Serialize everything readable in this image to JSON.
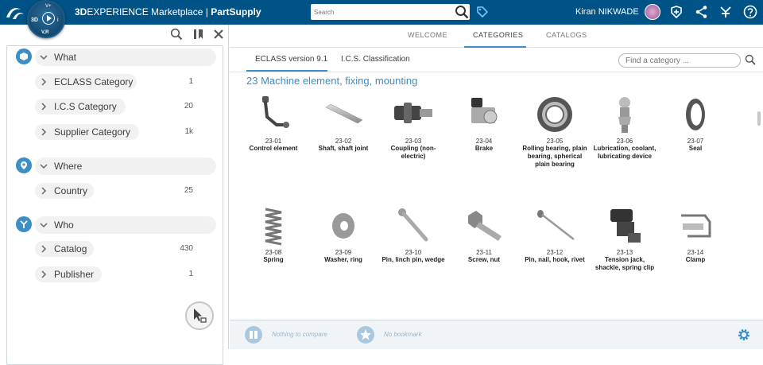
{
  "topbar": {
    "title_prefix": "3D",
    "title_rest": "EXPERIENCE Marketplace | ",
    "title_bold": "PartSupply",
    "search_placeholder": "Search",
    "user_name": "Kiran NIKWADE",
    "compass": {
      "top": "V+",
      "left": "3D",
      "right": "i",
      "bottom": "V,R"
    },
    "color": "#005386"
  },
  "left_panel": {
    "sections": [
      {
        "label": "What",
        "icon": "cube-icon",
        "items": [
          {
            "label": "ECLASS Category",
            "count": "1"
          },
          {
            "label": "I.C.S Category",
            "count": "20"
          },
          {
            "label": "Supplier Category",
            "count": "1k"
          }
        ]
      },
      {
        "label": "Where",
        "icon": "location-pin-icon",
        "items": [
          {
            "label": "Country",
            "count": "25"
          }
        ]
      },
      {
        "label": "Who",
        "icon": "people-icon",
        "items": [
          {
            "label": "Catalog",
            "count": "430"
          },
          {
            "label": "Publisher",
            "count": "1"
          }
        ]
      }
    ],
    "accent": "#3b8fc5"
  },
  "main": {
    "tabs": [
      {
        "label": "WELCOME"
      },
      {
        "label": "CATEGORIES"
      },
      {
        "label": "CATALOGS"
      }
    ],
    "active_tab": "CATEGORIES",
    "sub_tabs": [
      {
        "label": "ECLASS version 9.1"
      },
      {
        "label": "I.C.S. Classification"
      }
    ],
    "find_placeholder": "Find a category ...",
    "category_title": "23 Machine element, fixing, mounting",
    "items": [
      {
        "code": "23-01",
        "name": "Control element"
      },
      {
        "code": "23-02",
        "name": "Shaft, shaft joint"
      },
      {
        "code": "23-03",
        "name": "Coupling (non-electric)"
      },
      {
        "code": "23-04",
        "name": "Brake"
      },
      {
        "code": "23-05",
        "name": "Rolling bearing, plain bearing, spherical plain bearing"
      },
      {
        "code": "23-06",
        "name": "Lubrication, coolant, lubricating device"
      },
      {
        "code": "23-07",
        "name": "Seal"
      },
      {
        "code": "23-08",
        "name": "Spring"
      },
      {
        "code": "23-09",
        "name": "Washer, ring"
      },
      {
        "code": "23-10",
        "name": "Pin, linch pin, wedge"
      },
      {
        "code": "23-11",
        "name": "Screw, nut"
      },
      {
        "code": "23-12",
        "name": "Pin, nail, hook, rivet"
      },
      {
        "code": "23-13",
        "name": "Tension jack, shackle, spring clip"
      },
      {
        "code": "23-14",
        "name": "Clamp"
      }
    ]
  },
  "bottom_bar": {
    "compare_text": "Nothing to compare",
    "bookmark_text": "No bookmark"
  }
}
